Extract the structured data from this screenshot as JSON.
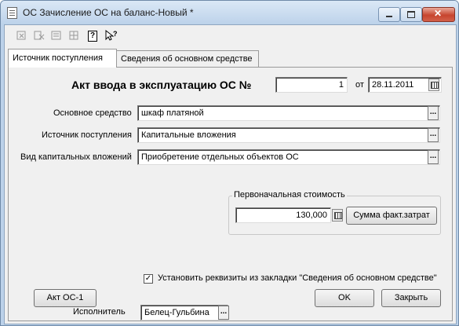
{
  "window": {
    "title": "ОС Зачисление ОС на баланс-Новый *"
  },
  "toolbar": {
    "icons": [
      "dx-icon",
      "dx-red-icon",
      "list-icon",
      "grid-icon",
      "help-icon",
      "help-pointer-icon"
    ],
    "help_glyph": "?",
    "help_pointer_glyph": "?"
  },
  "tabs": [
    {
      "label": "Источник поступления",
      "selected": true
    },
    {
      "label": "Сведения об основном средстве",
      "selected": false
    }
  ],
  "act": {
    "heading": "Акт ввода в эксплуатацию ОС №",
    "number": "1",
    "date_label": "от",
    "date": "28.11.2011"
  },
  "fields": {
    "asset_label": "Основное средство",
    "asset_value": "шкаф платяной",
    "source_label": "Источник поступления",
    "source_value": "Капитальные вложения",
    "capex_label": "Вид капитальных вложений",
    "capex_value": "Приобретение отдельных объектов ОС"
  },
  "cost": {
    "group_title": "Первоначальная стоимость",
    "value": "130,000",
    "fact_button": "Сумма факт.затрат"
  },
  "checkbox": {
    "checked": true,
    "label": "Установить реквизиты из закладки \"Сведения об основном средстве\""
  },
  "buttons": {
    "akt": "Акт ОС-1",
    "ok": "OK",
    "close": "Закрыть"
  },
  "executor": {
    "label": "Исполнитель",
    "value": "Белец-Гульбина"
  },
  "glyphs": {
    "dots": "...",
    "check": "✓"
  }
}
